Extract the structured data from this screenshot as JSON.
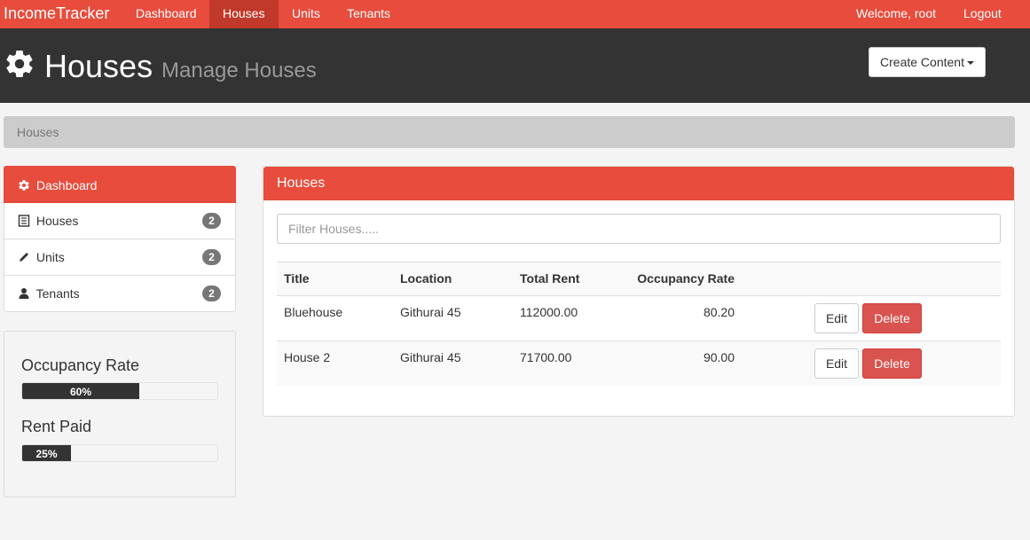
{
  "navbar": {
    "brand": "IncomeTracker",
    "items": [
      {
        "label": "Dashboard"
      },
      {
        "label": "Houses"
      },
      {
        "label": "Units"
      },
      {
        "label": "Tenants"
      }
    ],
    "welcome": "Welcome, root",
    "logout": "Logout",
    "accent_color": "#e74c3c",
    "active_color": "#c0392b"
  },
  "header": {
    "icon": "gear-icon",
    "title": "Houses",
    "subtitle": "Manage Houses",
    "create_button": "Create Content"
  },
  "breadcrumb": {
    "current": "Houses"
  },
  "sidebar": {
    "items": [
      {
        "label": "Dashboard",
        "icon": "gear-icon"
      },
      {
        "label": "Houses",
        "icon": "list-icon",
        "count": "2"
      },
      {
        "label": "Units",
        "icon": "pencil-icon",
        "count": "2"
      },
      {
        "label": "Tenants",
        "icon": "user-icon",
        "count": "2"
      }
    ],
    "stats": [
      {
        "title": "Occupancy Rate",
        "percent_label": "60%",
        "value": 0.6
      },
      {
        "title": "Rent Paid",
        "percent_label": "25%",
        "value": 0.25
      }
    ]
  },
  "panel": {
    "heading": "Houses",
    "filter_placeholder": "Filter Houses.....",
    "filter_value": "",
    "columns": [
      "Title",
      "Location",
      "Total Rent",
      "Occupancy Rate"
    ],
    "rows": [
      {
        "title": "Bluehouse",
        "location": "Githurai 45",
        "total_rent": "112000.00",
        "occupancy": "80.20",
        "edit": "Edit",
        "delete": "Delete"
      },
      {
        "title": "House 2",
        "location": "Githurai 45",
        "total_rent": "71700.00",
        "occupancy": "90.00",
        "edit": "Edit",
        "delete": "Delete"
      }
    ]
  }
}
